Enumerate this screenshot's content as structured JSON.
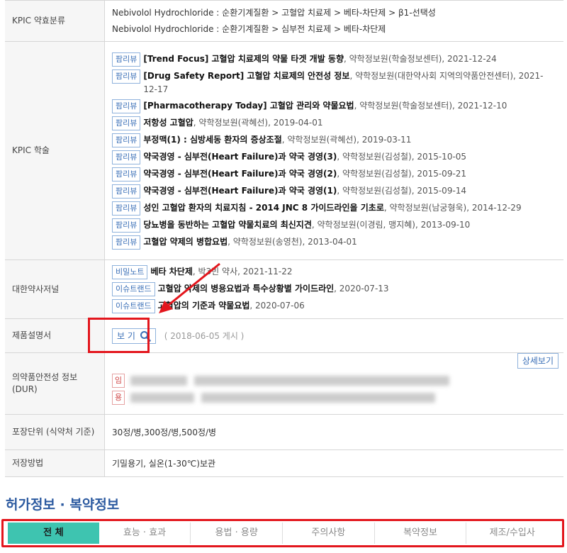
{
  "rows": {
    "kpic_class": {
      "label": "KPIC 약효분류",
      "lines": [
        "Nebivolol Hydrochloride : 순환기계질환 > 고혈압 치료제 > 베타-차단제 > β1-선택성",
        "Nebivolol Hydrochloride : 순환기계질환 > 심부전 치료제 > 베타-차단제"
      ]
    },
    "kpic_study": {
      "label": "KPIC 학술",
      "entries": [
        {
          "tag": "팜리뷰",
          "title": "[Trend Focus] 고혈압 치료제의 약물 타겟 개발 동향",
          "meta": ", 약학정보원(학술정보센터), 2021-12-24"
        },
        {
          "tag": "팜리뷰",
          "title": "[Drug Safety Report] 고혈압 치료제의 안전성 정보",
          "meta": ", 약학정보원(대한약사회 지역의약품안전센터), 2021-12-17"
        },
        {
          "tag": "팜리뷰",
          "title": "[Pharmacotherapy Today] 고혈압 관리와 약물요법",
          "meta": ", 약학정보원(학술정보센터), 2021-12-10"
        },
        {
          "tag": "팜리뷰",
          "title": "저항성 고혈압",
          "meta": ", 약학정보원(곽혜선), 2019-04-01"
        },
        {
          "tag": "팜리뷰",
          "title": "부정맥(1) : 심방세동 환자의 증상조절",
          "meta": ", 약학정보원(곽혜선), 2019-03-11"
        },
        {
          "tag": "팜리뷰",
          "title": "약국경영 - 심부전(Heart Failure)과 약국 경영(3)",
          "meta": ", 약학정보원(김성철), 2015-10-05"
        },
        {
          "tag": "팜리뷰",
          "title": "약국경영 - 심부전(Heart Failure)과 약국 경영(2)",
          "meta": ", 약학정보원(김성철), 2015-09-21"
        },
        {
          "tag": "팜리뷰",
          "title": "약국경영 - 심부전(Heart Failure)과 약국 경영(1)",
          "meta": ", 약학정보원(김성철), 2015-09-14"
        },
        {
          "tag": "팜리뷰",
          "title": "성인 고혈압 환자의 치료지침 - 2014 JNC 8 가이드라인을 기초로",
          "meta": ", 약학정보원(남궁형욱), 2014-12-29"
        },
        {
          "tag": "팜리뷰",
          "title": "당뇨병을 동반하는 고혈압 약물치료의 최신지견",
          "meta": ", 약학정보원(이경림, 맹지혜), 2013-09-10"
        },
        {
          "tag": "팜리뷰",
          "title": "고혈압 약제의 병합요법",
          "meta": ", 약학정보원(송영천), 2013-04-01"
        }
      ]
    },
    "journal": {
      "label": "대한약사저널",
      "entries": [
        {
          "tag": "비밀노트",
          "title": "베타 차단제",
          "meta": ", 박3빈 약사, 2021-11-22"
        },
        {
          "tag": "이슈트랜드",
          "title": "고혈압 약제의 병용요법과 특수상황별 가이드라인",
          "meta": ", 2020-07-13"
        },
        {
          "tag": "이슈트랜드",
          "title": "고혈압의 기준과 약물요법",
          "meta": ", 2020-07-06"
        }
      ]
    },
    "product_doc": {
      "label": "제품설명서",
      "button": "보 기",
      "date_note": "( 2018-06-05 게시 )"
    },
    "dur": {
      "label": "의약품안전성 정보(DUR)",
      "detail_button": "상세보기",
      "tags": [
        "임",
        "용"
      ]
    },
    "packaging": {
      "label": "포장단위 (식약처 기준)",
      "value": "30정/병,300정/병,500정/병"
    },
    "storage": {
      "label": "저장방법",
      "value": "기밀용기, 실온(1-30℃)보관"
    }
  },
  "section_title": "허가정보 · 복약정보",
  "tabs": [
    "전 체",
    "효능 · 효과",
    "용법 · 용량",
    "주의사항",
    "복약정보",
    "제조/수입사"
  ],
  "active_tab": "전 체",
  "colors": {
    "accent": "#3ec4b0",
    "highlight": "#e3161d",
    "title": "#2c5aa0",
    "tag_border": "#8fb2dc"
  },
  "icons": {
    "search": "magnifier-icon",
    "arrow": "red-arrow-icon"
  }
}
